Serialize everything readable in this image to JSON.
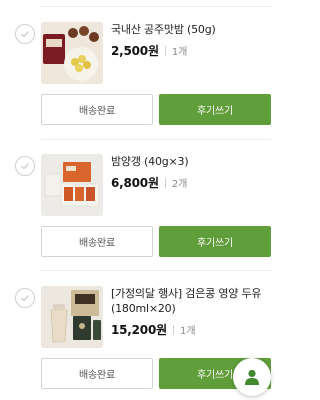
{
  "orders": [
    {
      "product_name": "국내산 공주맛밤 (50g)",
      "price": "2,500원",
      "quantity": "1개",
      "shipping_status": "배송완료",
      "review_label": "후기쓰기"
    },
    {
      "product_name": "밤양갱 (40g×3)",
      "price": "6,800원",
      "quantity": "2개",
      "shipping_status": "배송완료",
      "review_label": "후기쓰기"
    },
    {
      "product_name": "[가정의달 행사] 검은콩 영양 두유 (180ml×20)",
      "price": "15,200원",
      "quantity": "1개",
      "shipping_status": "배송완료",
      "review_label": "후기쓰기"
    }
  ],
  "icons": {
    "check": "check-icon",
    "profile": "person-icon"
  },
  "colors": {
    "accent": "#5f9e3a",
    "profile_icon": "#3f8a2e"
  }
}
